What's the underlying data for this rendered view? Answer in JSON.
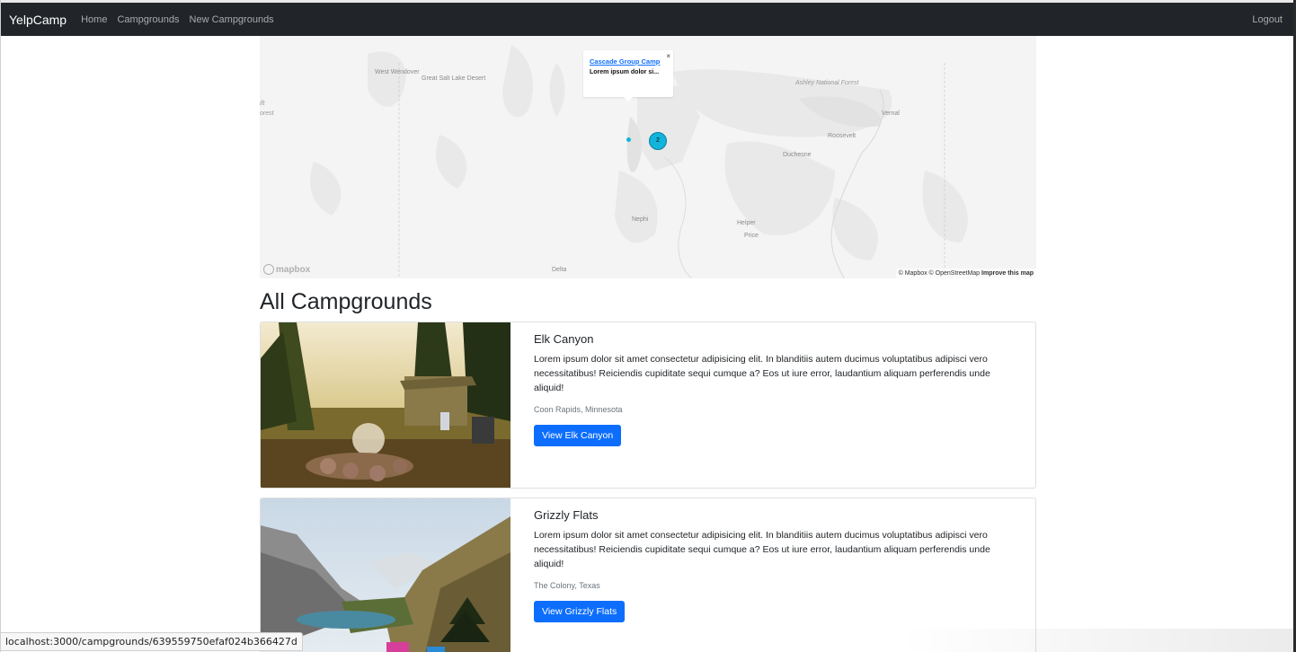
{
  "navbar": {
    "brand": "YelpCamp",
    "links": [
      "Home",
      "Campgrounds",
      "New Campgrounds"
    ],
    "logout": "Logout"
  },
  "map": {
    "labels": {
      "west_wendover": "West Wendover",
      "great_salt_lake_desert": "Great Salt Lake Desert",
      "ashley_forest": "Ashley National Forest",
      "vernal": "Vernal",
      "roosevelt": "Roosevelt",
      "duchesne": "Duchesne",
      "nephi": "Nephi",
      "helper": "Helper",
      "price": "Price",
      "delta": "Delta",
      "fragment_1": "ift",
      "fragment_2": "orest"
    },
    "cluster_count": "2",
    "popup": {
      "title": "Cascade Group Camp",
      "text": "Lorem ipsum dolor si...",
      "close": "×"
    },
    "logo_text": "mapbox",
    "attribution": "© Mapbox © OpenStreetMap",
    "attribution_bold": "Improve this map"
  },
  "page_title": "All Campgrounds",
  "campgrounds": [
    {
      "title": "Elk Canyon",
      "description": "Lorem ipsum dolor sit amet consectetur adipisicing elit. In blanditiis autem ducimus voluptatibus adipisci vero necessitatibus! Reiciendis cupiditate sequi cumque a? Eos ut iure error, laudantium aliquam perferendis unde aliquid!",
      "location": "Coon Rapids, Minnesota",
      "button": "View Elk Canyon"
    },
    {
      "title": "Grizzly Flats",
      "description": "Lorem ipsum dolor sit amet consectetur adipisicing elit. In blanditiis autem ducimus voluptatibus adipisci vero necessitatibus! Reiciendis cupiditate sequi cumque a? Eos ut iure error, laudantium aliquam perferendis unde aliquid!",
      "location": "The Colony, Texas",
      "button": "View Grizzly Flats"
    }
  ],
  "status_url": "localhost:3000/campgrounds/639559750efaf024b366427d",
  "colors": {
    "navbar_bg": "#212529",
    "primary": "#0d6efd",
    "cluster": "#11b4da"
  }
}
